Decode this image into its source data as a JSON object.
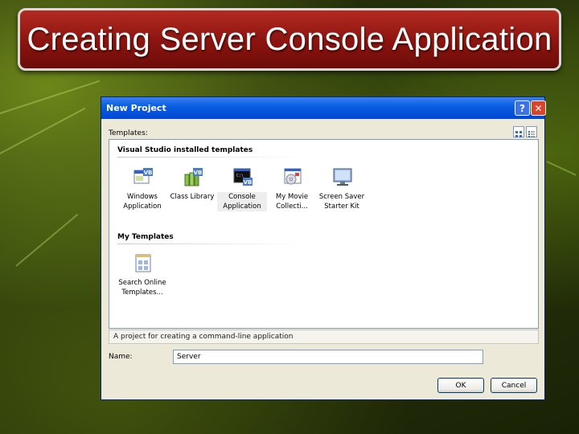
{
  "slide": {
    "title": "Creating Server Console Application"
  },
  "dialog": {
    "title": "New Project",
    "help_glyph": "?",
    "close_glyph": "✕",
    "templates_label": "Templates:",
    "groups": [
      {
        "header": "Visual Studio installed templates",
        "items": [
          {
            "label": "Windows Application",
            "icon": "vb-windows-app-icon"
          },
          {
            "label": "Class Library",
            "icon": "vb-class-library-icon"
          },
          {
            "label": "Console Application",
            "icon": "vb-console-app-icon",
            "selected": true
          },
          {
            "label": "My Movie Collecti...",
            "icon": "movie-collection-icon"
          },
          {
            "label": "Screen Saver Starter Kit",
            "icon": "screen-saver-icon"
          }
        ]
      },
      {
        "header": "My Templates",
        "items": [
          {
            "label": "Search Online Templates...",
            "icon": "search-online-templates-icon"
          }
        ]
      }
    ],
    "description": "A project for creating a command-line application",
    "name_label": "Name:",
    "name_value": "Server",
    "ok_label": "OK",
    "cancel_label": "Cancel"
  },
  "colors": {
    "slide_title_bg": "#8a1410",
    "dialog_titlebar": "#0a5fe0",
    "dialog_bg": "#ece9d8"
  }
}
